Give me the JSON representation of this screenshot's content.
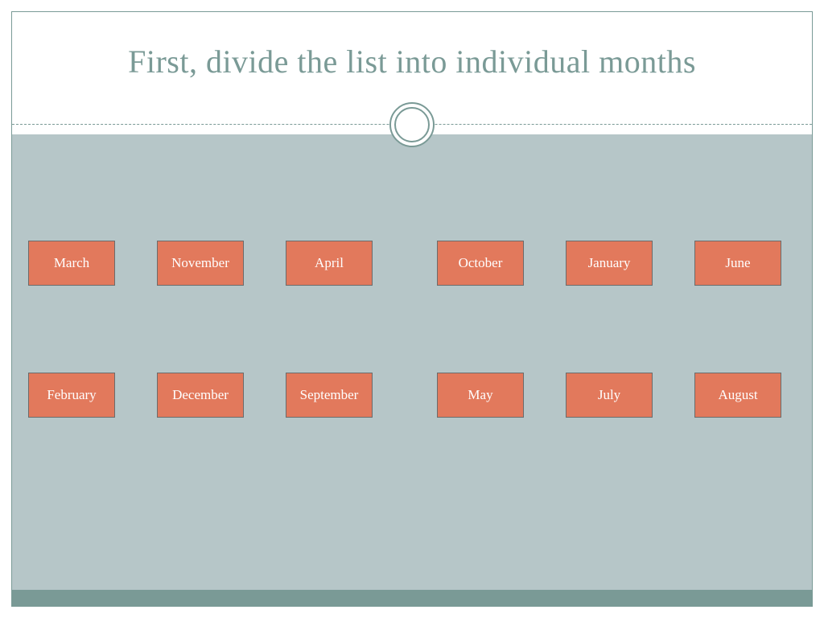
{
  "title": "First, divide the list into individual months",
  "months_row1": [
    "March",
    "November",
    "April",
    "October",
    "January",
    "June"
  ],
  "months_row2": [
    "February",
    "December",
    "September",
    "May",
    "July",
    "August"
  ]
}
